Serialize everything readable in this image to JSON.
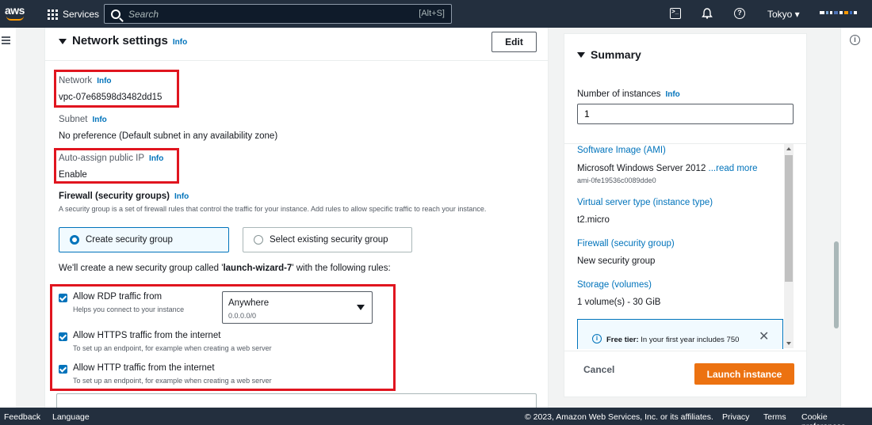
{
  "topnav": {
    "logo": "aws",
    "services": "Services",
    "search_placeholder": "Search",
    "search_shortcut": "[Alt+S]",
    "region": "Tokyo ▾",
    "account_colors": [
      "#ffffff",
      "#7aa7d8",
      "#ffffff",
      "#4f74b8",
      "#ffffff",
      "#ff9900",
      "#3b6fc7",
      "#ffffff"
    ]
  },
  "network": {
    "title": "Network settings",
    "info": "Info",
    "edit": "Edit",
    "network_label": "Network",
    "network_value": "vpc-07e68598d3482dd15",
    "subnet_label": "Subnet",
    "subnet_value": "No preference (Default subnet in any availability zone)",
    "publicip_label": "Auto-assign public IP",
    "publicip_value": "Enable",
    "firewall_title": "Firewall (security groups)",
    "firewall_desc": "A security group is a set of firewall rules that control the traffic for your instance. Add rules to allow specific traffic to reach your instance.",
    "create_sg": "Create security group",
    "select_sg": "Select existing security group",
    "sg_note_prefix": "We'll create a new security group called '",
    "sg_name": "launch-wizard-7",
    "sg_note_suffix": "' with the following rules:",
    "rules": [
      {
        "label": "Allow RDP traffic from",
        "desc": "Helps you connect to your instance",
        "checked": true
      },
      {
        "label": "Allow HTTPS traffic from the internet",
        "desc": "To set up an endpoint, for example when creating a web server",
        "checked": true
      },
      {
        "label": "Allow HTTP traffic from the internet",
        "desc": "To set up an endpoint, for example when creating a web server",
        "checked": true
      }
    ],
    "rdp_source": "Anywhere",
    "rdp_cidr": "0.0.0.0/0"
  },
  "summary": {
    "title": "Summary",
    "instances_label": "Number of instances",
    "instances_value": "1",
    "ami_link": "Software Image (AMI)",
    "ami_value": "Microsoft Windows Server 2012 ",
    "ami_readmore": "...read more",
    "ami_id": "ami-0fe19536c0089dde0",
    "type_link": "Virtual server type (instance type)",
    "type_value": "t2.micro",
    "fw_link": "Firewall (security group)",
    "fw_value": "New security group",
    "storage_link": "Storage (volumes)",
    "storage_value": "1 volume(s) - 30 GiB",
    "freetier_bold": "Free tier:",
    "freetier_text": " In your first year includes 750",
    "cancel": "Cancel",
    "launch": "Launch instance"
  },
  "footer": {
    "feedback": "Feedback",
    "language": "Language",
    "copyright": "© 2023, Amazon Web Services, Inc. or its affiliates.",
    "privacy": "Privacy",
    "terms": "Terms",
    "cookies": "Cookie preferences"
  },
  "colors": {
    "accent": "#0073bb",
    "launch": "#ec7211",
    "highlight": "#e0151f",
    "nav": "#232f3e"
  }
}
